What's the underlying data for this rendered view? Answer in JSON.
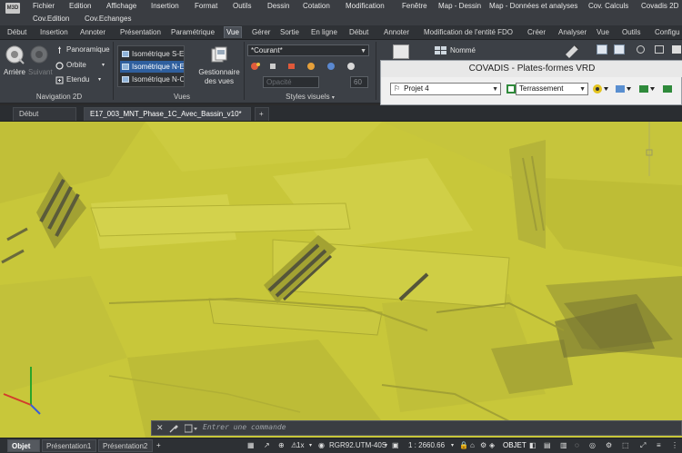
{
  "app": {
    "icon_label": "M3D"
  },
  "menubar": {
    "row1": [
      "Fichier",
      "Edition",
      "Affichage",
      "Insertion",
      "Format",
      "Outils",
      "Dessin",
      "Cotation",
      "Modification",
      "Fenêtre",
      "Map - Dessin",
      "Map - Données et analyses",
      "Cov. Calculs",
      "Covadis 2D"
    ],
    "row2": [
      "Cov.Edition",
      "Cov.Echanges"
    ]
  },
  "ribbon_tabs": [
    "Début",
    "Insertion",
    "Annoter",
    "Présentation",
    "Paramétrique",
    "Vue",
    "Gérer",
    "Sortie",
    "En ligne",
    "Début",
    "Annoter",
    "Modification de l'entité FDO",
    "Créer",
    "Analyser",
    "Vue",
    "Outils",
    "Configu"
  ],
  "ribbon": {
    "navigation": {
      "title": "Navigation 2D",
      "back": "Arrière",
      "forward": "Suivant",
      "pan": "Panoramique",
      "orbit": "Orbite",
      "extents": "Etendu"
    },
    "views": {
      "title": "Vues",
      "items": [
        "Isométrique S-E",
        "Isométrique N-E",
        "Isométrique N-O"
      ],
      "selected_index": 1,
      "manager": [
        "Gestionnaire",
        "des vues"
      ]
    },
    "visual_styles": {
      "title": "Styles visuels",
      "current": "*Courant*",
      "opacity_label": "Opacité",
      "opacity_value": "60"
    },
    "named": "Nommé"
  },
  "covadis": {
    "title": "COVADIS - Plates-formes VRD",
    "project": "Projet 4",
    "layer": "Terrassement"
  },
  "doc_tabs": [
    "Début",
    "E17_003_MNT_Phase_1C_Avec_Bassin_v10*"
  ],
  "doc_active_index": 1,
  "command": {
    "placeholder": "Entrer une commande"
  },
  "status": {
    "layout_tabs": [
      "Objet",
      "Présentation1",
      "Présentation2"
    ],
    "active_layout_index": 0,
    "scale_factor": "1x",
    "coord_system": "RGR92.UTM-40S",
    "scale": "1 : 2660.66",
    "objet": "OBJET"
  },
  "colors": {
    "terrain": "#c9c83a",
    "ribbon_bg": "#3c4046",
    "selection": "#2f5f9e"
  }
}
